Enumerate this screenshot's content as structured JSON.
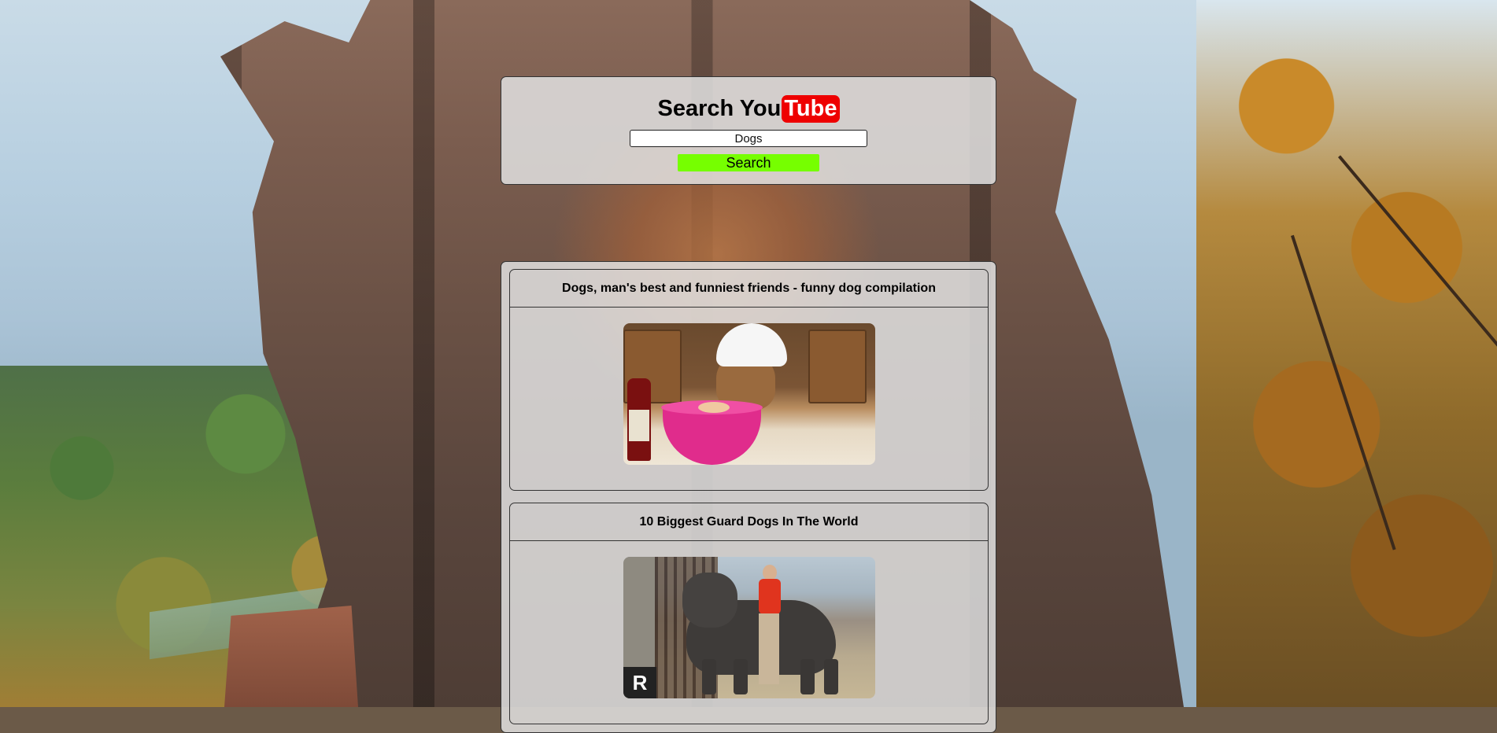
{
  "header": {
    "title_prefix": "Search You",
    "title_brand": "Tube",
    "brand_color": "#ee0000"
  },
  "search": {
    "value": "Dogs",
    "button_label": "Search",
    "button_color": "#76ff00"
  },
  "results": [
    {
      "title": "Dogs, man's best and funniest friends - funny dog compilation"
    },
    {
      "title": "10 Biggest Guard Dogs In The World",
      "thumb_logo": "R"
    }
  ]
}
